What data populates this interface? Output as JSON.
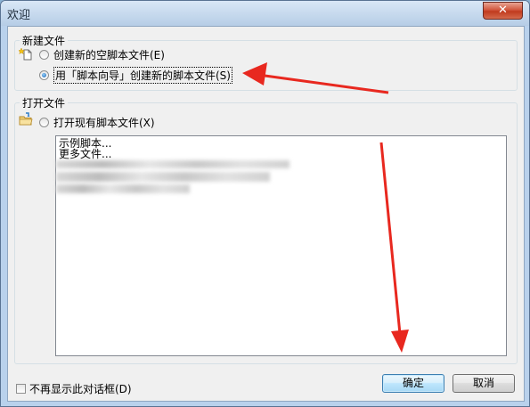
{
  "window": {
    "title": "欢迎",
    "close_glyph": "✕"
  },
  "new_file": {
    "group_label": "新建文件",
    "option_blank": "创建新的空脚本文件(E)",
    "option_wizard": "用「脚本向导」创建新的脚本文件(S)",
    "selected": "option_wizard"
  },
  "open_file": {
    "group_label": "打开文件",
    "option_existing": "打开现有脚本文件(X)",
    "list_items": [
      "示例脚本...",
      "更多文件..."
    ]
  },
  "footer": {
    "dont_show_label": "不再显示此对话框(D)",
    "ok_label": "确定",
    "cancel_label": "取消"
  },
  "colors": {
    "annotation_arrow": "#e8281f"
  },
  "icons": {
    "new_file": "new-file-icon",
    "open_file": "open-folder-icon"
  }
}
